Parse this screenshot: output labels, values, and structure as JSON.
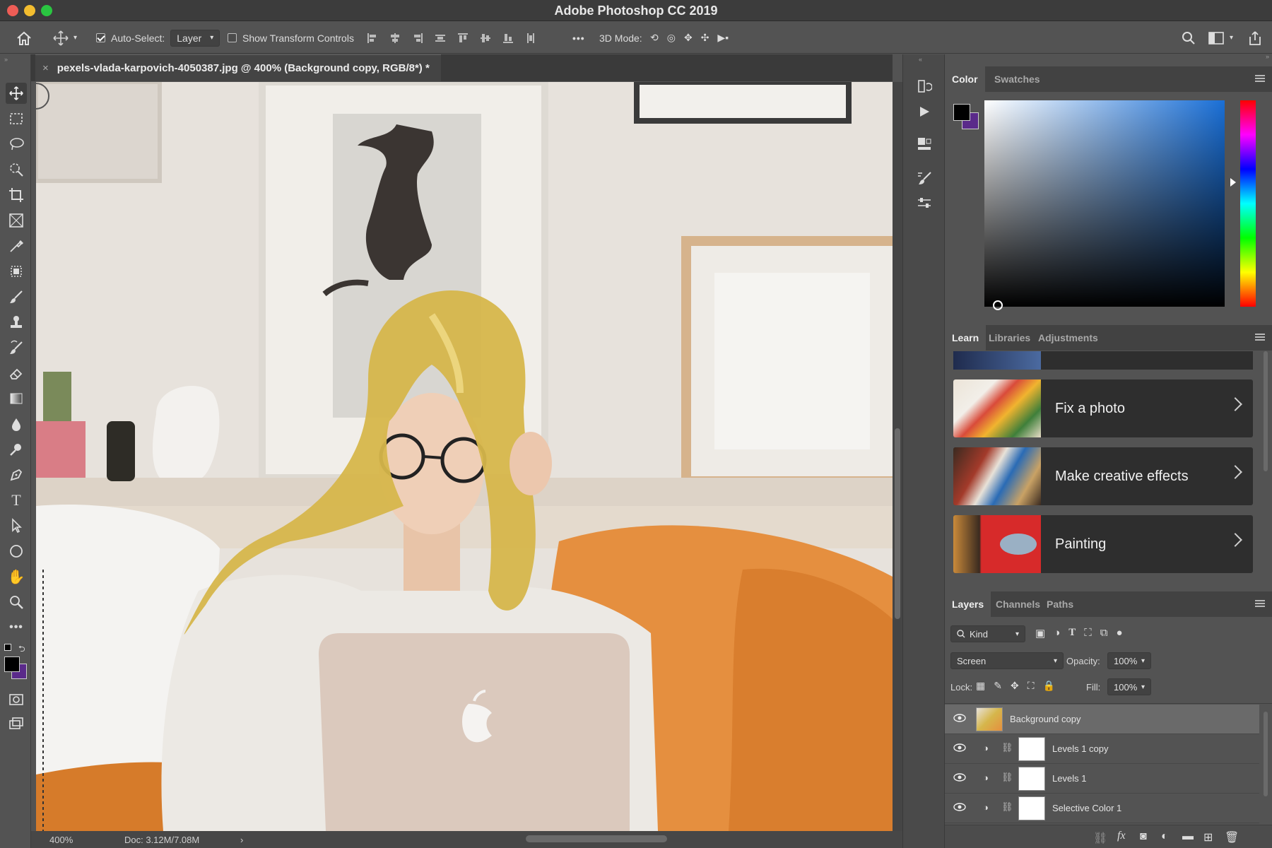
{
  "window": {
    "title": "Adobe Photoshop CC 2019"
  },
  "options_bar": {
    "auto_select_label": "Auto-Select:",
    "auto_select_checked": true,
    "auto_select_value": "Layer",
    "show_transform_label": "Show Transform Controls",
    "more": "•••",
    "mode_3d_label": "3D Mode:"
  },
  "document": {
    "tab_title": "pexels-vlada-karpovich-4050387.jpg @ 400% (Background copy, RGB/8*) *",
    "close_glyph": "×"
  },
  "status": {
    "zoom": "400%",
    "doc": "Doc: 3.12M/7.08M",
    "arrow": "›"
  },
  "panels": {
    "color_group": {
      "tabs": [
        "Color",
        "Swatches"
      ],
      "active": "Color",
      "foreground": "#000000",
      "background": "#5a2a8a"
    },
    "learn_group": {
      "tabs": [
        "Learn",
        "Libraries",
        "Adjustments"
      ],
      "active": "Learn",
      "cards": [
        {
          "label": "Fix a photo",
          "thumb": "flowers-photo"
        },
        {
          "label": "Make creative effects",
          "thumb": "paint-brushes-photo"
        },
        {
          "label": "Painting",
          "thumb": "fish-painting"
        }
      ]
    },
    "layers_group": {
      "tabs": [
        "Layers",
        "Channels",
        "Paths"
      ],
      "active": "Layers",
      "filter_kind": "Kind",
      "blend_mode": "Screen",
      "opacity_label": "Opacity:",
      "opacity_value": "100%",
      "lock_label": "Lock:",
      "fill_label": "Fill:",
      "fill_value": "100%",
      "layers": [
        {
          "name": "Background copy",
          "selected": true,
          "type": "pixel"
        },
        {
          "name": "Levels 1 copy",
          "selected": false,
          "type": "adjustment"
        },
        {
          "name": "Levels 1",
          "selected": false,
          "type": "adjustment"
        },
        {
          "name": "Selective Color 1",
          "selected": false,
          "type": "adjustment"
        }
      ]
    }
  },
  "colors": {
    "accent_hair": "#d8b84a",
    "panel": "#535353",
    "panel_dark": "#424242"
  }
}
